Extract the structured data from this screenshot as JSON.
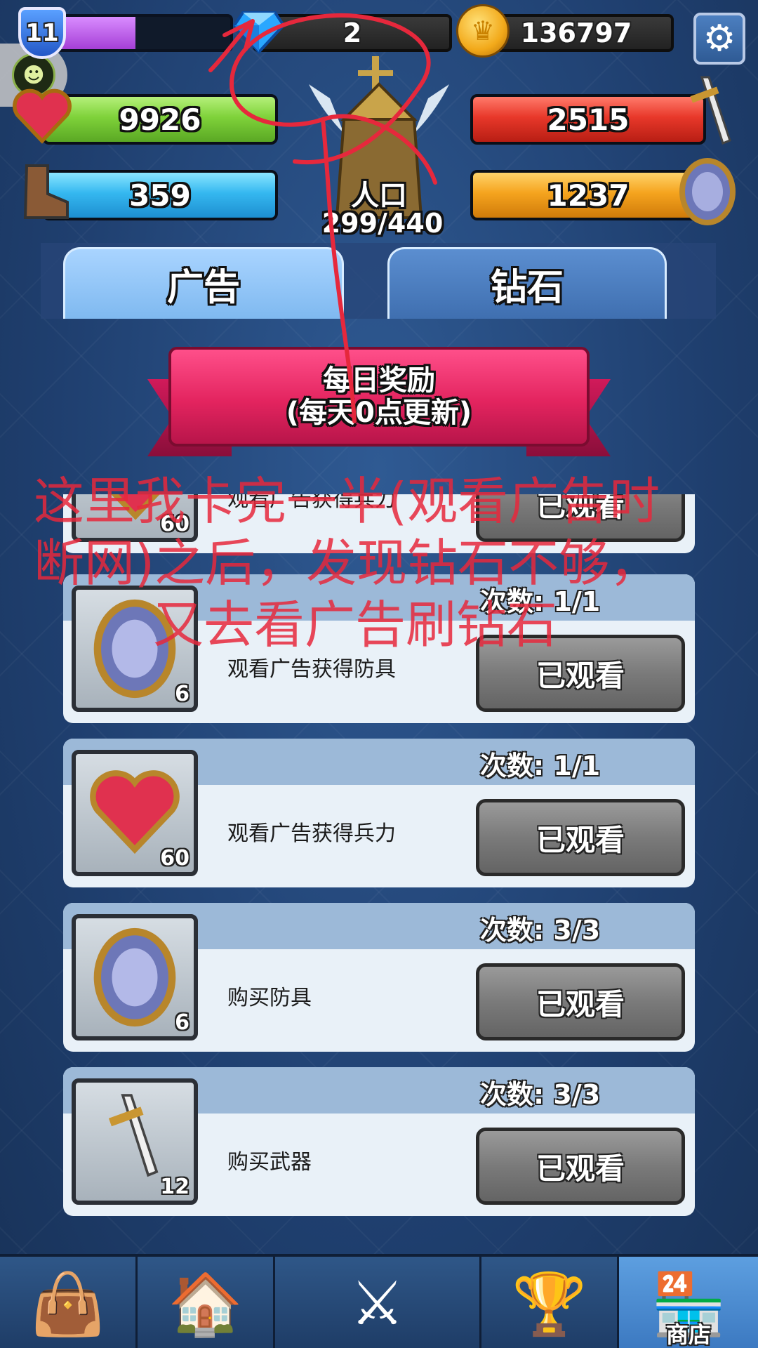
{
  "header": {
    "level": "11",
    "xp_fill": 0.47,
    "gems": "2",
    "gold": "136797"
  },
  "stats": {
    "troops": "9926",
    "attack": "2515",
    "speed": "359",
    "defense": "1237"
  },
  "castle": {
    "population_label": "人口",
    "population_value": "299/440"
  },
  "tabs": [
    {
      "label": "广告",
      "active": true
    },
    {
      "label": "钻石",
      "active": false
    }
  ],
  "ribbon": {
    "line1": "每日奖励",
    "line2": "(每天0点更新)"
  },
  "cards": [
    {
      "qty": "60",
      "desc": "观看广告获得兵力",
      "count": "",
      "button": "已观看",
      "icon": "heart-icon"
    },
    {
      "qty": "6",
      "desc": "观看广告获得防具",
      "count": "次数: 1/1",
      "button": "已观看",
      "icon": "shield-icon"
    },
    {
      "qty": "60",
      "desc": "观看广告获得兵力",
      "count": "次数: 1/1",
      "button": "已观看",
      "icon": "heart-icon"
    },
    {
      "qty": "6",
      "desc": "购买防具",
      "count": "次数: 3/3",
      "button": "已观看",
      "icon": "shield-icon"
    },
    {
      "qty": "12",
      "desc": "购买武器",
      "count": "次数: 3/3",
      "button": "已观看",
      "icon": "sword-icon"
    }
  ],
  "annotation": {
    "line1": "这里我卡完一半(观看广告时",
    "line2": "断网)之后，发现钻石不够，",
    "line3": "又去看广告刷钻石"
  },
  "nav": [
    {
      "icon": "bag-icon",
      "label": ""
    },
    {
      "icon": "house-icon",
      "label": ""
    },
    {
      "icon": "crossed-swords-icon",
      "label": ""
    },
    {
      "icon": "trophy-icon",
      "label": ""
    },
    {
      "icon": "shop-icon",
      "label": "商店"
    }
  ],
  "colors": {
    "annotation": "#e6283c",
    "ribbon": "#e3245f",
    "tab_active": "#a9d4ff"
  }
}
